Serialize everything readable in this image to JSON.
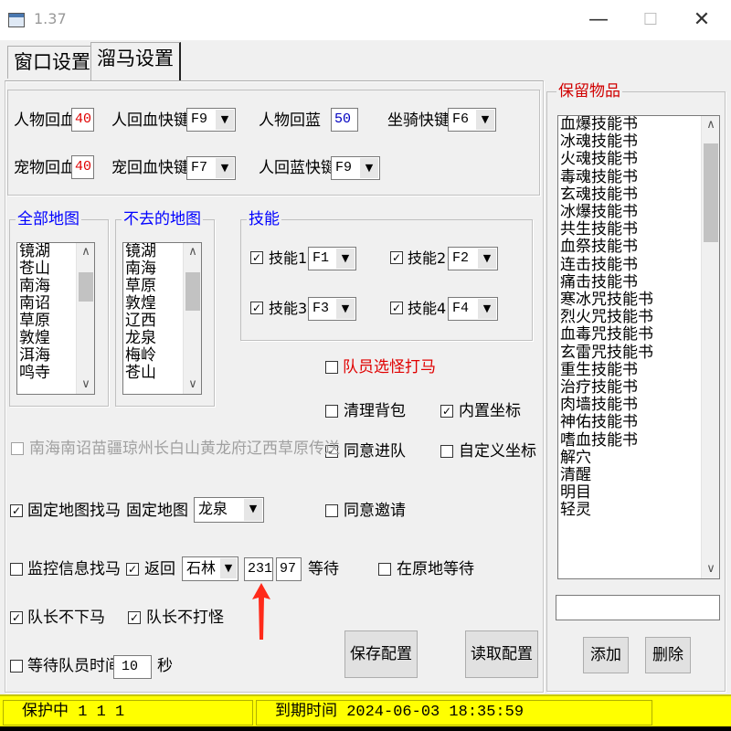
{
  "window": {
    "title": "1.37",
    "min_glyph": "—",
    "max_glyph": "☐",
    "close_glyph": "✕"
  },
  "tabs": [
    "窗口设置",
    "溜马设置"
  ],
  "top": {
    "hp_label": "人物回血",
    "hp_value": "40",
    "hp_key_label": "人回血快键",
    "hp_key": "F9",
    "mp_label": "人物回蓝",
    "mp_value": "50",
    "mount_key_label": "坐骑快键",
    "mount_key": "F6",
    "pet_label": "宠物回血",
    "pet_value": "40",
    "pet_key_label": "宠回血快键",
    "pet_key": "F7",
    "mp_key_label": "人回蓝快键",
    "mp_key": "F9"
  },
  "all_maps": {
    "title": "全部地图",
    "items": [
      "镜湖",
      "苍山",
      "南海",
      "南诏",
      "草原",
      "敦煌",
      "洱海",
      "鸣寺"
    ]
  },
  "skip_maps": {
    "title": "不去的地图",
    "items": [
      "镜湖",
      "南海",
      "草原",
      "敦煌",
      "辽西",
      "龙泉",
      "梅岭",
      "苍山"
    ]
  },
  "skills": {
    "title": "技能",
    "items": [
      {
        "label": "技能1",
        "key": "F1",
        "checked": "✓"
      },
      {
        "label": "技能2",
        "key": "F2",
        "checked": "✓"
      },
      {
        "label": "技能3",
        "key": "F3",
        "checked": "✓"
      },
      {
        "label": "技能4",
        "key": "F4",
        "checked": "✓"
      }
    ]
  },
  "route_text": "南海南诏苗疆琼州长白山黄龙府辽西草原传送",
  "options": {
    "member_pick": "队员选怪打马",
    "clean_bag": "清理背包",
    "builtin_coord": "内置坐标",
    "agree_team": "同意进队",
    "custom_coord": "自定义坐标",
    "agree_invite": "同意邀请",
    "fixed_map_label": "固定地图找马",
    "fixed_map_select_label": "固定地图",
    "fixed_map_value": "龙泉",
    "monitor_label": "监控信息找马",
    "return_label": "返回",
    "return_map": "石林",
    "coord_x": "231",
    "coord_y": "97",
    "wait_label": "等待",
    "wait_here": "在原地等待",
    "leader_no_dismount": "队长不下马",
    "leader_no_fight": "队长不打怪",
    "wait_member_label": "等待队员时间",
    "wait_seconds": "10",
    "seconds_unit": "秒"
  },
  "buttons": {
    "save": "保存配置",
    "load": "读取配置",
    "add": "添加",
    "delete": "删除"
  },
  "keep_items": {
    "title": "保留物品",
    "items": [
      "血爆技能书",
      "冰魂技能书",
      "火魂技能书",
      "毒魂技能书",
      "玄魂技能书",
      "冰爆技能书",
      "共生技能书",
      "血祭技能书",
      "连击技能书",
      "痛击技能书",
      "寒冰咒技能书",
      "烈火咒技能书",
      "血毒咒技能书",
      "玄雷咒技能书",
      "重生技能书",
      "治疗技能书",
      "肉墙技能书",
      "神佑技能书",
      "嗜血技能书",
      "解穴",
      "清醒",
      "明目",
      "轻灵"
    ],
    "input": ""
  },
  "status": {
    "left": "保护中  1 1 1",
    "right": "到期时间 2024-06-03 18:35:59"
  },
  "colors": {
    "accent_blue": "#0000ff",
    "accent_red": "#d00000",
    "status_bg": "#ffff00",
    "arrow": "#ff2a1a"
  }
}
